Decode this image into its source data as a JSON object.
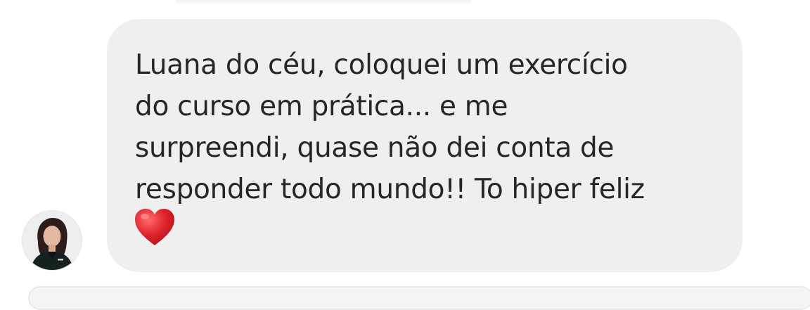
{
  "conversation": {
    "message": {
      "text": "Luana do céu, coloquei um exercício\ndo curso em prática... e me\nsurpreendi, quase não dei conta de\nresponder todo mundo!! To hiper feliz",
      "emoji": "heart-emoji"
    },
    "sender": {
      "avatar": "profile-photo"
    }
  },
  "colors": {
    "bubble_background": "#efefef",
    "text": "#262626",
    "heart": "#e0242c",
    "page_background": "#ffffff"
  }
}
